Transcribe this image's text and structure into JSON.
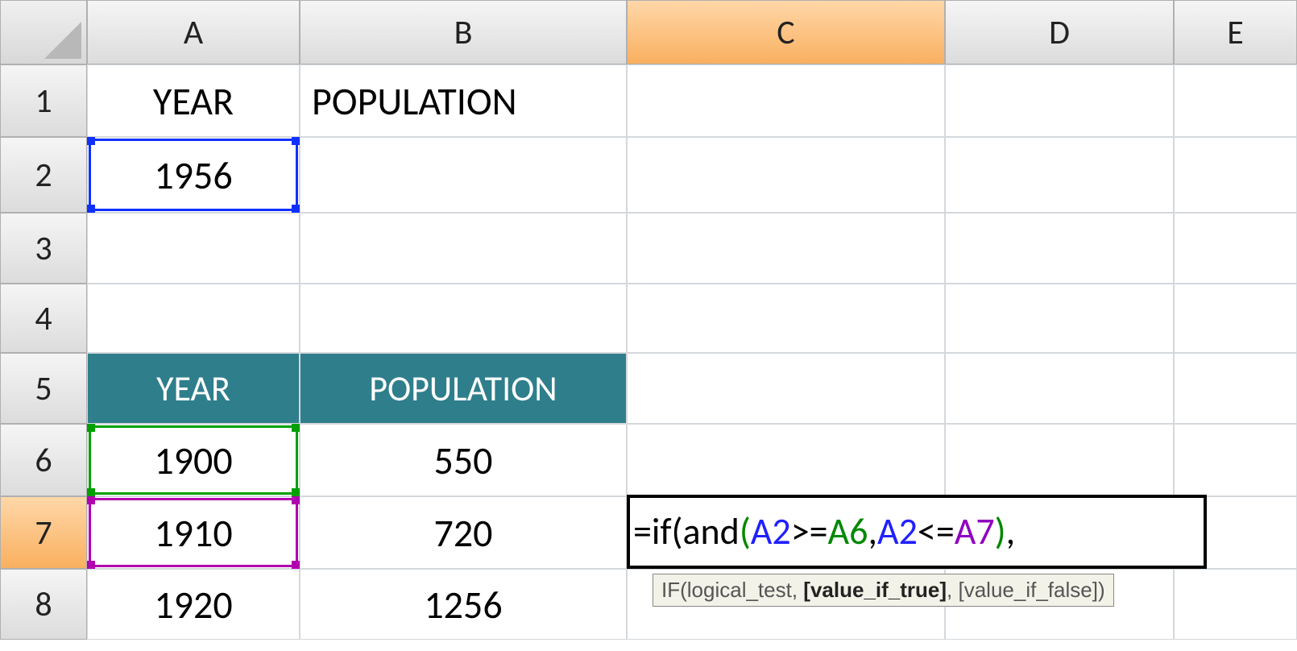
{
  "columns": [
    "A",
    "B",
    "C",
    "D",
    "E"
  ],
  "rows": [
    "1",
    "2",
    "3",
    "4",
    "5",
    "6",
    "7",
    "8"
  ],
  "active_column": "C",
  "active_row": "7",
  "cells": {
    "A1": "YEAR",
    "B1": "POPULATION",
    "A2": "1956",
    "A5": "YEAR",
    "B5": "POPULATION",
    "A6": "1900",
    "B6": "550",
    "A7": "1910",
    "B7": "720",
    "A8": "1920",
    "B8": "1256"
  },
  "formula": {
    "prefix": "=if(and",
    "p1": "(",
    "ref1": "A2",
    "op1": ">=",
    "ref2": "A6",
    "sep": ",",
    "ref3": "A2",
    "op2": "<=",
    "ref4": "A7",
    "p2": ")",
    "tail": ","
  },
  "tooltip": {
    "fn": "IF(",
    "arg1": "logical_test",
    "comma1": ", ",
    "arg2": "[value_if_true]",
    "comma2": ", ",
    "arg3": "[value_if_false]",
    "close": ")"
  }
}
